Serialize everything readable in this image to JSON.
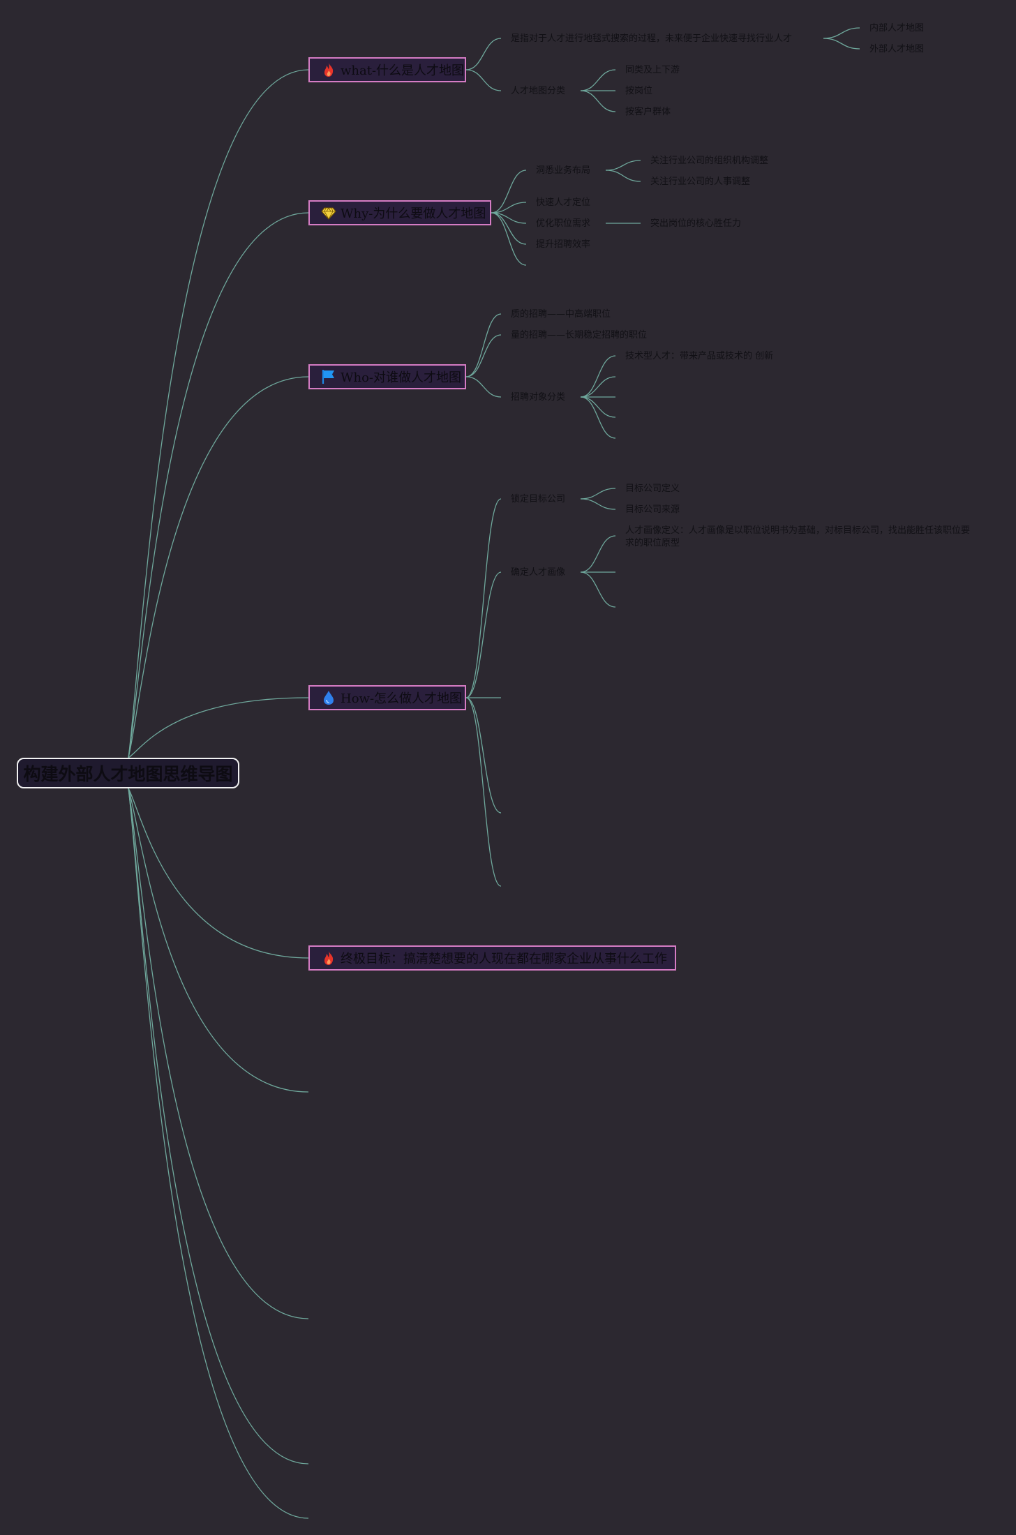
{
  "root": {
    "label": "构建外部人才地图思维导图"
  },
  "branches": {
    "what": {
      "label": "what-什么是人才地图",
      "icon": "fire-icon",
      "definition": "是指对于人才进行地毯式搜索的过程，未来便于企业快速寻找行业人才",
      "definition_children": [
        "内部人才地图",
        "外部人才地图"
      ],
      "category": "人才地图分类",
      "category_children": [
        "同类及上下游",
        "按岗位",
        "按客户群体"
      ]
    },
    "why": {
      "label": "Why-为什么要做人才地图",
      "icon": "diamond-icon",
      "items": [
        "洞悉业务布局",
        "快速人才定位",
        "优化职位需求",
        "提升招聘效率"
      ],
      "insight_children": [
        "关注行业公司的组织机构调整",
        "关注行业公司的人事调整"
      ],
      "optimize_child": "突出岗位的核心胜任力"
    },
    "who": {
      "label": "Who-对谁做人才地图",
      "icon": "flag-icon",
      "items": [
        "质的招聘——中高端职位",
        "量的招聘——长期稳定招聘的职位",
        "招聘对象分类"
      ],
      "type_children": [
        "技术型人才：带来产品或技术的 创新"
      ]
    },
    "how": {
      "label": "How-怎么做人才地图",
      "icon": "water-drop-icon",
      "items": [
        "锁定目标公司",
        "确定人才画像"
      ],
      "company_children": [
        "目标公司定义",
        "目标公司来源"
      ],
      "portrait_children": [
        "人才画像定义：人才画像是以职位说明书为基础，对标目标公司，找出能胜任该职位要求的职位原型"
      ]
    },
    "goal": {
      "label": "终极目标：搞清楚想要的人现在都在哪家企业从事什么工作",
      "icon": "fire-icon"
    }
  },
  "colors": {
    "background": "#2c2830",
    "connector": "#6fa89c",
    "branch_border": "#d57cc4",
    "branch_fill": "#2a1f3c",
    "root_border": "#f2f2f2",
    "root_fill": "#1f1a2e",
    "text": "#111015"
  }
}
